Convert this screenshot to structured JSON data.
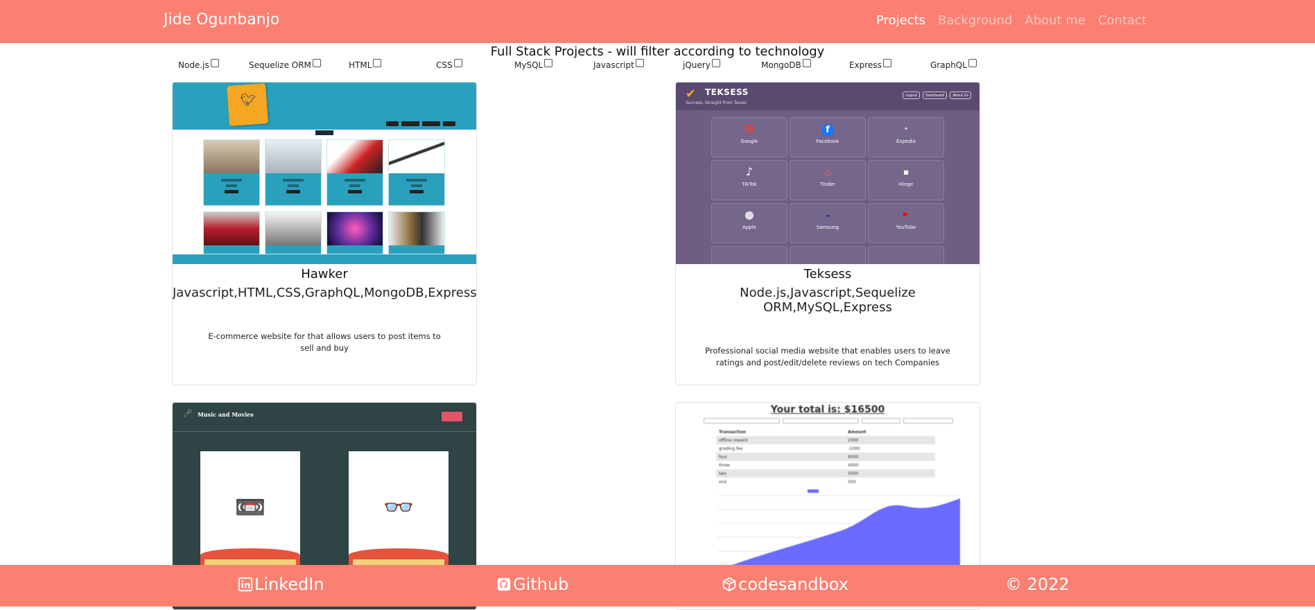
{
  "nav": {
    "brand": "Jide Ogunbanjo",
    "links": [
      {
        "label": "Projects",
        "active": true
      },
      {
        "label": "Background",
        "active": false
      },
      {
        "label": "About me",
        "active": false
      },
      {
        "label": "Contact",
        "active": false
      }
    ]
  },
  "main": {
    "heading": "Full Stack Projects - will filter according to technology",
    "filters": [
      "Node.js",
      "Sequelize ORM",
      "HTML",
      "CSS",
      "MySQL",
      "Javascript",
      "jQuery",
      "MongoDB",
      "Express",
      "GraphQL"
    ]
  },
  "projects": [
    {
      "title": "Hawker",
      "tech": "Javascript,HTML,CSS,GraphQL,MongoDB,Express",
      "description": "E-commerce website for that allows users to post items to sell and buy"
    },
    {
      "title": "Teksess",
      "tech": "Node.js,Javascript,Sequelize ORM,MySQL,Express",
      "description": "Professional social media website that enables users to leave ratings and post/edit/delete reviews on tech Companies",
      "screenshot": {
        "name": "TEKSESS",
        "tagline": "Success, Straight from Texas!",
        "buttons": [
          "Logout",
          "Dashboard",
          "About Us"
        ],
        "companies": [
          "Google",
          "Facebook",
          "Expedia",
          "TikTok",
          "Tinder",
          "Hinge",
          "Apple",
          "Samsung",
          "YouTube"
        ]
      }
    },
    {
      "screenshot": {
        "title": "Music and Movies"
      }
    },
    {
      "screenshot": {
        "total": "Your total is: $16500",
        "columns": [
          "Transaction",
          "Amount"
        ],
        "rows": [
          [
            "offline reward",
            "2000"
          ],
          [
            "grading fee",
            "-1000"
          ],
          [
            "four",
            "6000"
          ],
          [
            "three",
            "4000"
          ],
          [
            "two",
            "5000"
          ],
          [
            "one",
            "500"
          ]
        ]
      }
    }
  ],
  "footer": {
    "linkedin": "LinkedIn",
    "github": "Github",
    "codesandbox": "codesandbox",
    "copyright": "© 2022"
  },
  "colors": {
    "accent": "#fa8072"
  }
}
